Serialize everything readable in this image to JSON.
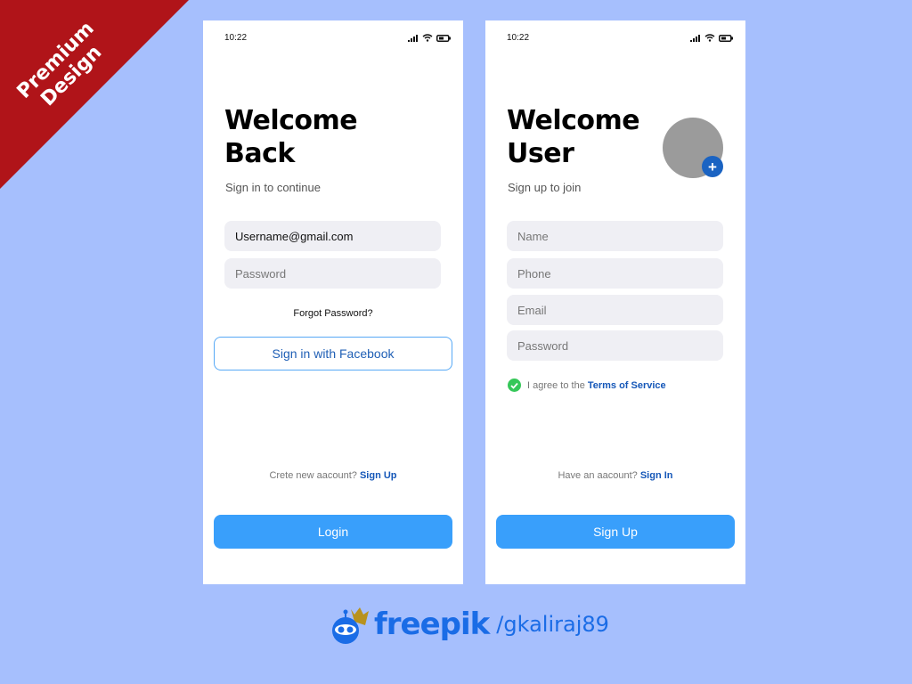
{
  "ribbon": {
    "line1": "Premium",
    "line2": "Design",
    "color": "#b01419"
  },
  "login_screen": {
    "status": {
      "time": "10:22",
      "icons": [
        "signal-icon",
        "wifi-icon",
        "battery-icon"
      ]
    },
    "title_line1": "Welcome",
    "title_line2": "Back",
    "subtitle": "Sign in to continue",
    "username_value": "Username@gmail.com",
    "password_placeholder": "Password",
    "forgot_password": "Forgot Password?",
    "facebook_button": "Sign in with Facebook",
    "bottom_prompt": "Crete new aacount?",
    "bottom_link": "Sign Up",
    "primary_button": "Login"
  },
  "signup_screen": {
    "status": {
      "time": "10:22",
      "icons": [
        "signal-icon",
        "wifi-icon",
        "battery-icon"
      ]
    },
    "title_line1": "Welcome",
    "title_line2": "User",
    "subtitle": "Sign up to join",
    "avatar_add_icon": "+",
    "fields": [
      {
        "placeholder": "Name"
      },
      {
        "placeholder": "Phone"
      },
      {
        "placeholder": "Email"
      },
      {
        "placeholder": "Password"
      }
    ],
    "terms_text": "I agree to the",
    "terms_link": "Terms of Service",
    "terms_checked": true,
    "bottom_prompt": "Have an aacount?",
    "bottom_link": "Sign In",
    "primary_button": "Sign Up"
  },
  "brand": {
    "name": "freepik",
    "handle": "/gkaliraj89"
  },
  "colors": {
    "background": "#a6bffd",
    "accent": "#399ffb",
    "link": "#1557b8",
    "field_bg": "#efeff4",
    "check": "#36c759"
  }
}
